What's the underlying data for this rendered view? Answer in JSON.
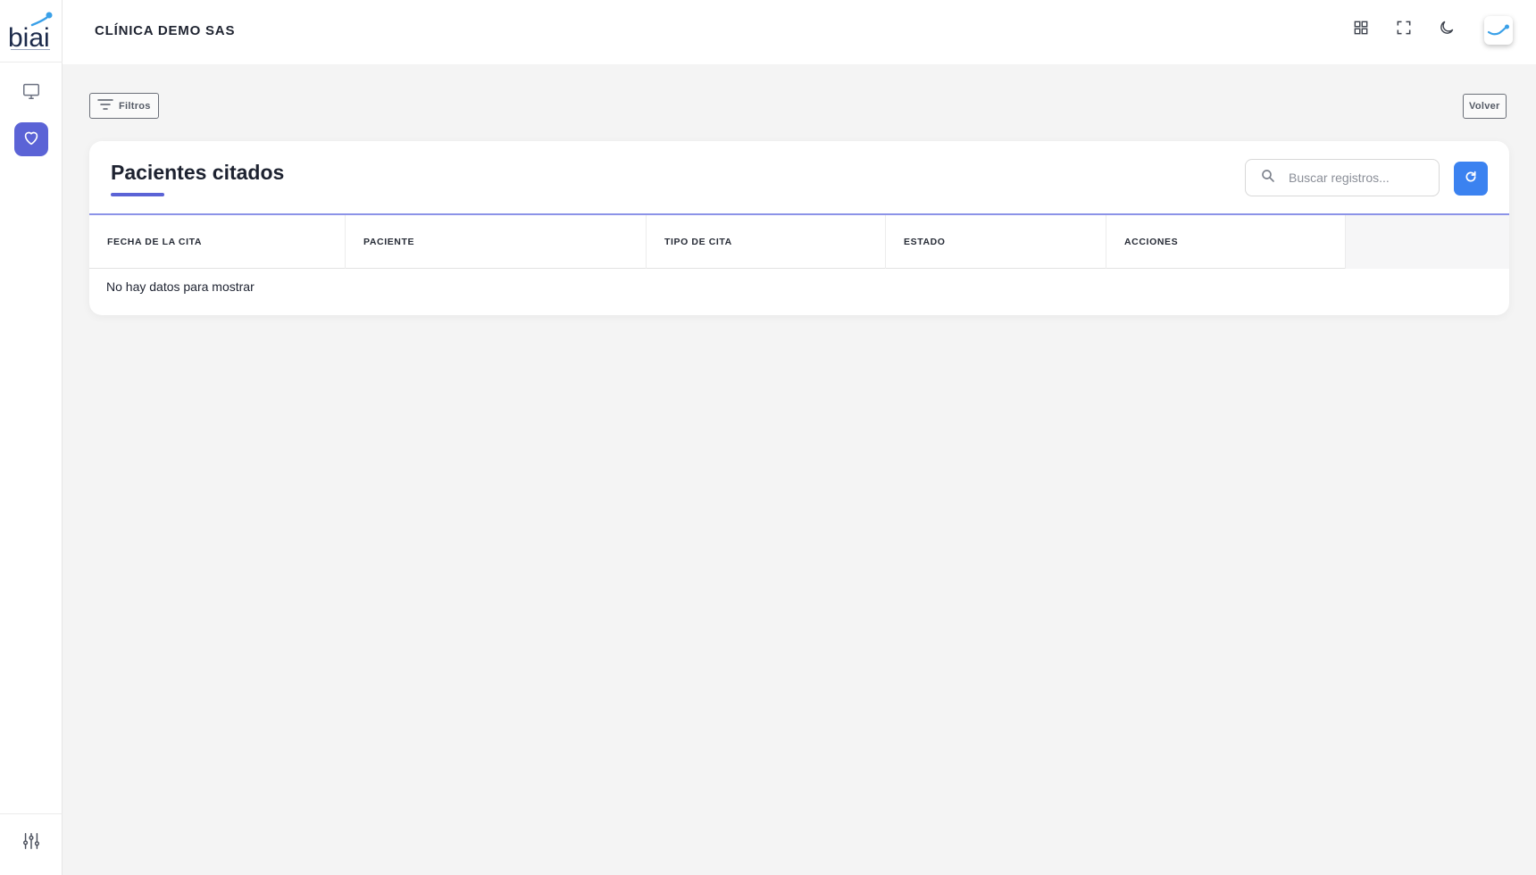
{
  "app": {
    "logo_text": "biai",
    "clinic_name": "CLÍNICA DEMO SAS"
  },
  "sidebar": {
    "items": [
      {
        "name": "monitor",
        "icon": "monitor-icon",
        "active": false
      },
      {
        "name": "heart",
        "icon": "heart-icon",
        "active": true
      }
    ],
    "footer_icon": "sliders-icon"
  },
  "header_icons": [
    "grid-icon",
    "fullscreen-icon",
    "moon-icon",
    "avatar"
  ],
  "toolbar": {
    "filters_label": "Filtros",
    "back_label": "Volver"
  },
  "card": {
    "title": "Pacientes citados",
    "search_placeholder": "Buscar registros...",
    "refresh_icon": "refresh-icon"
  },
  "table": {
    "columns": [
      "FECHA DE LA CITA",
      "PACIENTE",
      "TIPO DE CITA",
      "ESTADO",
      "ACCIONES"
    ],
    "empty_message": "No hay datos para mostrar"
  },
  "colors": {
    "accent": "#5b63d6",
    "primary_button": "#3b82f0",
    "background": "#f4f4f4"
  }
}
